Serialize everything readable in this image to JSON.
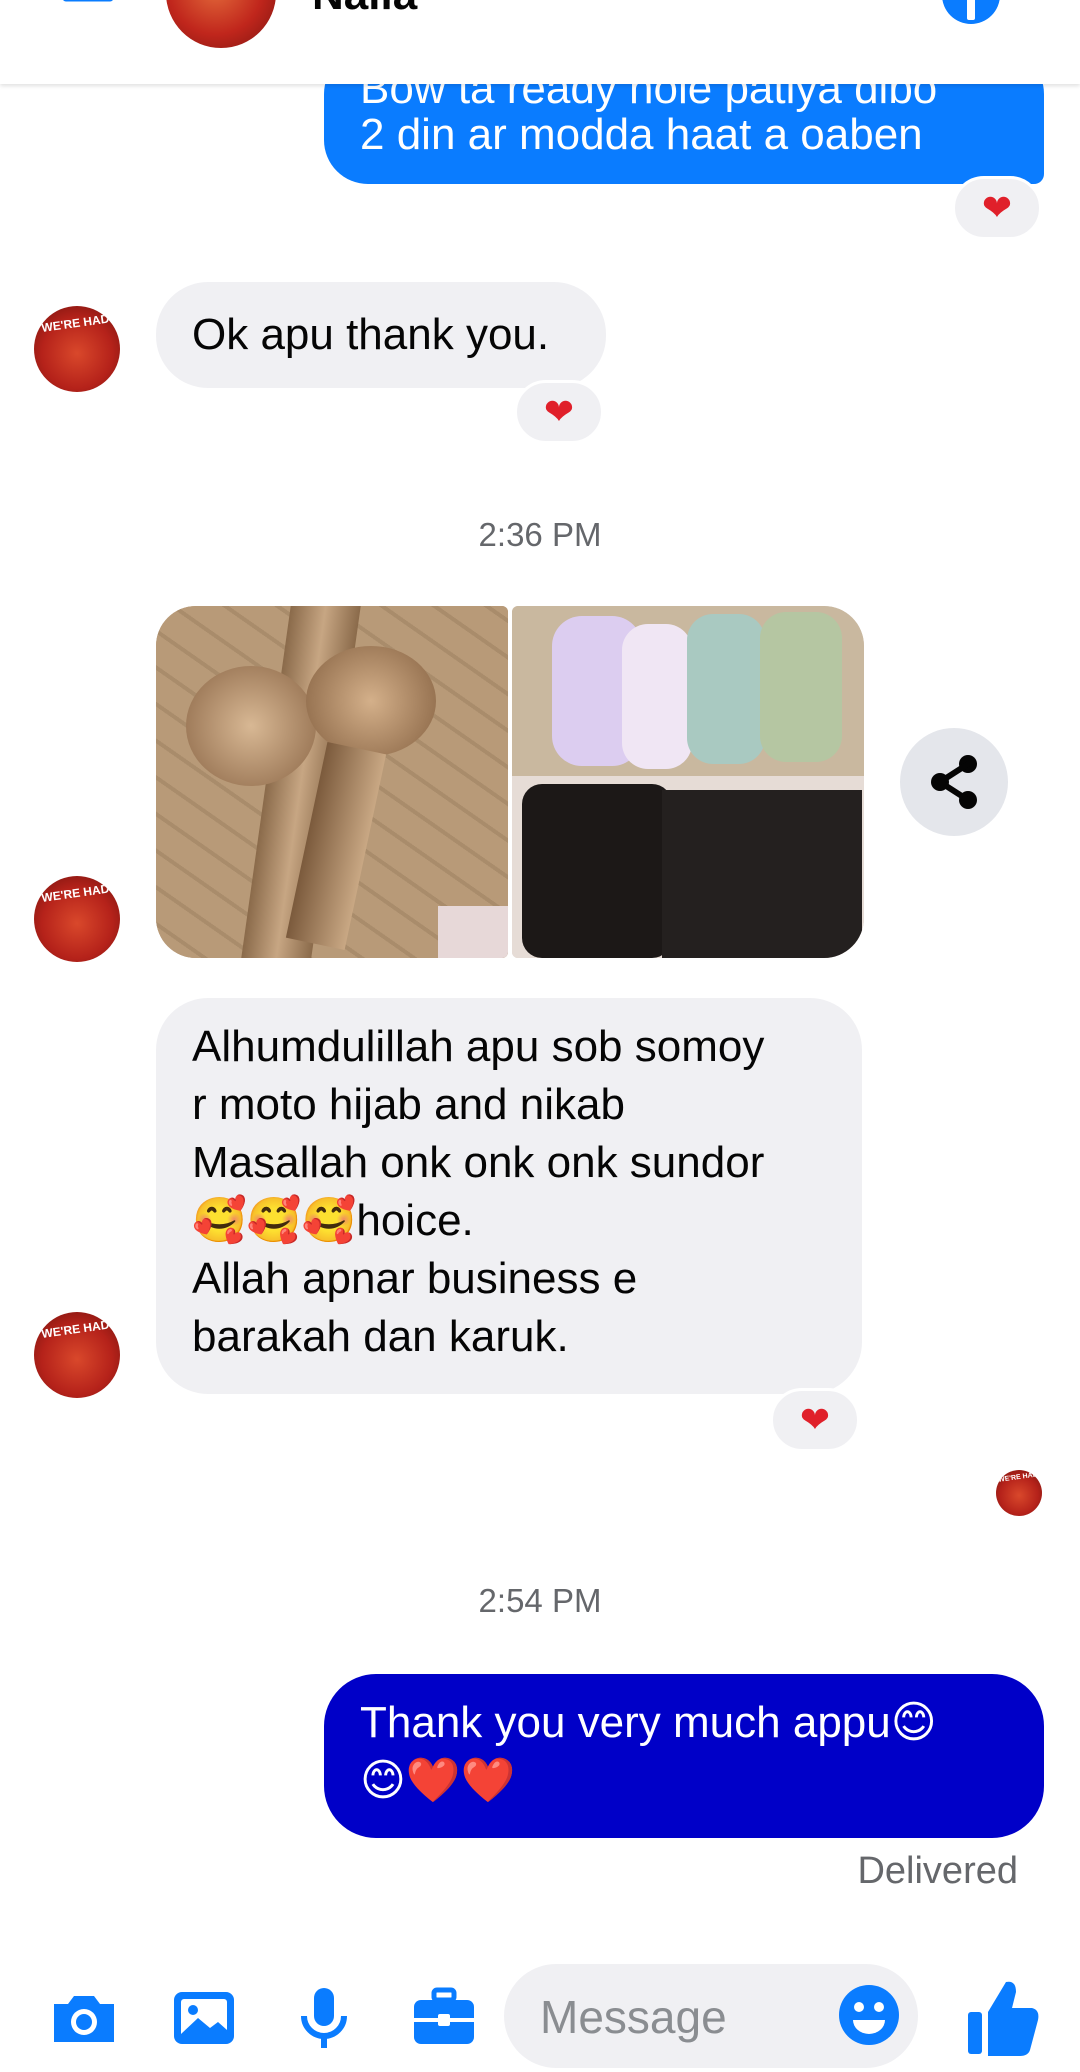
{
  "header": {
    "contact_name": "Naila"
  },
  "messages": {
    "out1_prev_line": "Bow ta ready hole patiya dibo",
    "out1_line": "2 din ar modda haat a oaben",
    "in1_text": "Ok apu thank you.",
    "time1": "2:36 PM",
    "in2_lines": [
      "Alhumdulillah apu sob somoy",
      "r moto hijab and nikab",
      "Masallah onk onk onk sundor",
      "🥰🥰🥰hoice.",
      "Allah apnar business e",
      "barakah dan karuk."
    ],
    "time2": "2:54 PM",
    "out2_lines": [
      "Thank you very much appu😊",
      "😊❤️❤️"
    ],
    "delivered": "Delivered",
    "reaction": "❤"
  },
  "avatar_text": "WE'RE HADI",
  "composer": {
    "placeholder": "Message"
  },
  "colors": {
    "brand_blue": "#0a7cff",
    "dark_blue": "#0000c8",
    "incoming_bg": "#f0f0f3"
  }
}
